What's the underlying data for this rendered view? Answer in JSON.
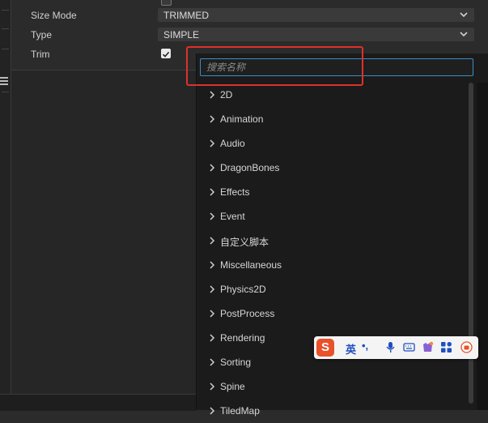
{
  "properties": {
    "size_mode": {
      "label": "Size Mode",
      "value": "TRIMMED"
    },
    "type": {
      "label": "Type",
      "value": "SIMPLE"
    },
    "trim": {
      "label": "Trim",
      "checked": true
    }
  },
  "popup": {
    "search_placeholder": "搜索名称",
    "categories": [
      "2D",
      "Animation",
      "Audio",
      "DragonBones",
      "Effects",
      "Event",
      "自定义脚本",
      "Miscellaneous",
      "Physics2D",
      "PostProcess",
      "Rendering",
      "Sorting",
      "Spine",
      "TiledMap"
    ]
  },
  "ime_toolbar": {
    "logo": "S",
    "lang": "英",
    "punct": "•,",
    "icons": [
      "microphone-icon",
      "keyboard-icon",
      "skin-icon",
      "grid-icon",
      "toolbox-icon"
    ]
  },
  "colors": {
    "accent": "#3a8fc2",
    "highlight": "#e0302a",
    "ime_brand": "#e8512a"
  }
}
